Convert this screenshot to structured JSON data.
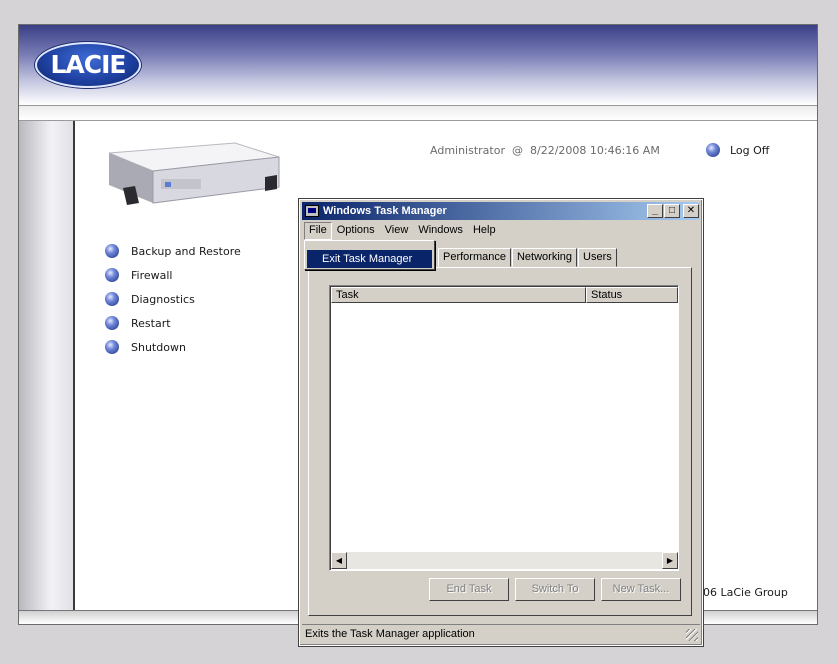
{
  "brand": {
    "logo_text": "LACIE"
  },
  "header": {
    "user": "Administrator",
    "separator": "@",
    "datetime": "8/22/2008 10:46:16 AM",
    "logoff_label": "Log Off"
  },
  "sidebar_menu": {
    "items": [
      {
        "label": "Backup and Restore"
      },
      {
        "label": "Firewall"
      },
      {
        "label": "Diagnostics"
      },
      {
        "label": "Restart"
      },
      {
        "label": "Shutdown"
      }
    ]
  },
  "footer": {
    "copyright": "006 LaCie Group"
  },
  "task_manager": {
    "title": "Windows Task Manager",
    "title_buttons": {
      "minimize": "_",
      "maximize": "□",
      "close": "✕"
    },
    "menu": [
      "File",
      "Options",
      "View",
      "Windows",
      "Help"
    ],
    "dropdown": {
      "item": "Exit Task Manager"
    },
    "tabs": [
      "Performance",
      "Networking",
      "Users"
    ],
    "list_columns": [
      "Task",
      "Status"
    ],
    "scroll_arrows": {
      "left": "◀",
      "right": "▶"
    },
    "buttons": {
      "end_task": "End Task",
      "switch_to": "Switch To",
      "new_task": "New Task..."
    },
    "status_text": "Exits the Task Manager application"
  },
  "colors": {
    "title_bar": "#0a246a",
    "accent_blue": "#1d3f9e",
    "window_face": "#d4d0c8"
  }
}
